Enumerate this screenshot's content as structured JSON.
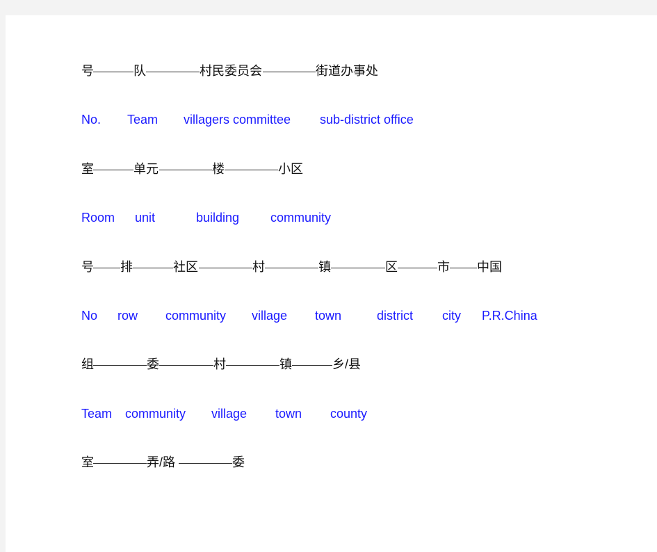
{
  "lines": [
    {
      "lang": "zh",
      "items": [
        "号",
        "队",
        "村民委员会",
        "街道办事处"
      ]
    },
    {
      "lang": "en",
      "items": [
        "No.",
        "Team",
        "villagers committee",
        "sub-district office"
      ]
    },
    {
      "lang": "zh",
      "items": [
        "室",
        "单元",
        "楼",
        "小区"
      ]
    },
    {
      "lang": "en",
      "items": [
        "Room",
        "unit",
        "building",
        "community"
      ]
    },
    {
      "lang": "zh",
      "items": [
        "号",
        "排",
        "社区",
        "村",
        "镇",
        "区",
        "市",
        "中国"
      ]
    },
    {
      "lang": "en",
      "items": [
        "No",
        "row",
        "community",
        "village",
        "town",
        "district",
        "city",
        "P.R.China"
      ]
    },
    {
      "lang": "zh",
      "items": [
        "组",
        "委",
        "村",
        "镇",
        "乡/县"
      ]
    },
    {
      "lang": "en",
      "items": [
        "Team",
        "community",
        "village",
        "town",
        "county"
      ]
    },
    {
      "lang": "zh",
      "items": [
        "室",
        "弄/路",
        "委"
      ]
    }
  ],
  "colors": {
    "chinese_text": "#111111",
    "english_text": "#1a1aff"
  }
}
